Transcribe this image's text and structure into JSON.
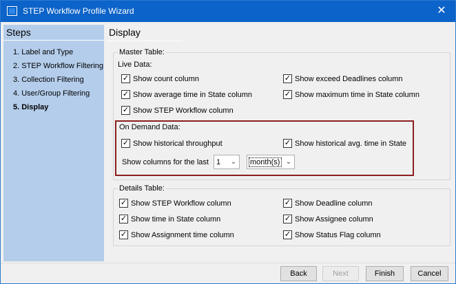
{
  "window": {
    "title": "STEP Workflow Profile Wizard",
    "close_glyph": "✕"
  },
  "sidebar": {
    "title": "Steps",
    "items": [
      {
        "label": "1. Label and Type"
      },
      {
        "label": "2. STEP Workflow Filtering"
      },
      {
        "label": "3. Collection Filtering"
      },
      {
        "label": "4. User/Group Filtering"
      },
      {
        "label": "5. Display",
        "current": true
      }
    ]
  },
  "main": {
    "title": "Display",
    "master_table": {
      "legend": "Master Table:",
      "live_data": {
        "label": "Live Data:",
        "checkboxes": [
          {
            "label": "Show count column",
            "checked": true
          },
          {
            "label": "Show exceed Deadlines column",
            "checked": true
          },
          {
            "label": "Show average time in State column",
            "checked": true
          },
          {
            "label": "Show maximum time in State column",
            "checked": true
          },
          {
            "label": "Show STEP Workflow column",
            "checked": true
          }
        ]
      },
      "on_demand": {
        "label": "On Demand Data:",
        "checkboxes": [
          {
            "label": "Show historical throughput",
            "checked": true
          },
          {
            "label": "Show historical avg. time in State",
            "checked": true
          }
        ],
        "period_label": "Show columns for the last",
        "count_value": "1",
        "unit_value": "month(s)"
      }
    },
    "details_table": {
      "legend": "Details Table:",
      "checkboxes": [
        {
          "label": "Show STEP Workflow column",
          "checked": true
        },
        {
          "label": "Show Deadline column",
          "checked": true
        },
        {
          "label": "Show time in State column",
          "checked": true
        },
        {
          "label": "Show Assignee column",
          "checked": true
        },
        {
          "label": "Show Assignment time column",
          "checked": true
        },
        {
          "label": "Show Status Flag column",
          "checked": true
        }
      ]
    }
  },
  "footer": {
    "back": "Back",
    "next": "Next",
    "finish": "Finish",
    "cancel": "Cancel"
  },
  "glyphs": {
    "check": "✓",
    "dropdown": "⌄"
  },
  "colors": {
    "titlebar": "#0c63c9",
    "sidebar": "#b4cdeb",
    "highlight_border": "#8b1e1e"
  }
}
